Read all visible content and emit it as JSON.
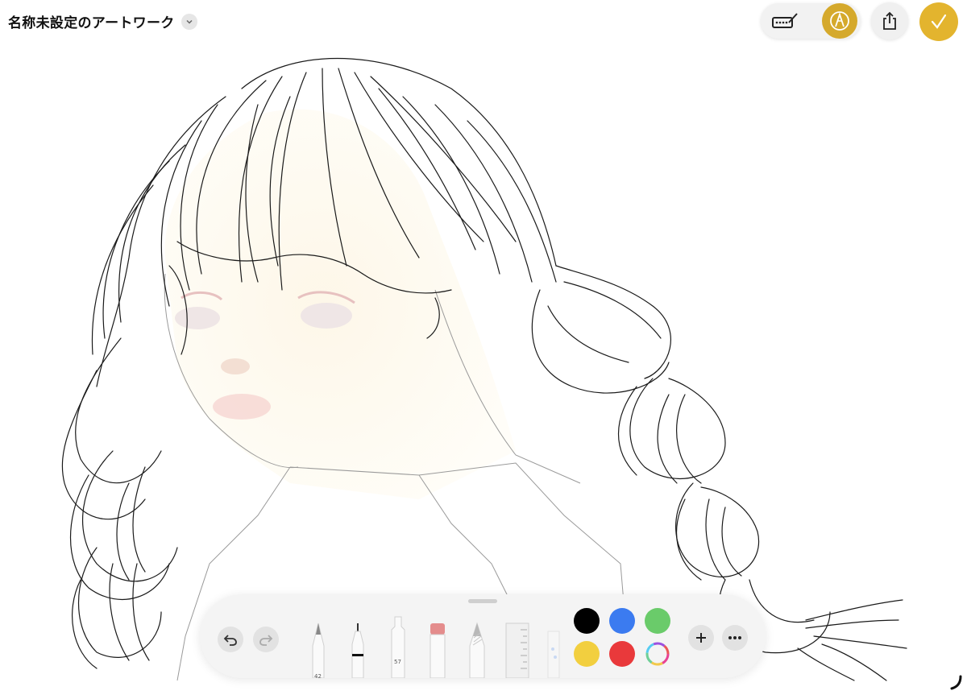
{
  "header": {
    "title": "名称未設定のアートワーク",
    "title_menu_icon": "chevron-down-icon"
  },
  "top_controls": {
    "markup_icon": "hand-drawing-icon",
    "pen_mode_icon": "pencil-tip-icon",
    "share_icon": "share-icon",
    "done_icon": "checkmark-icon",
    "accent_color": "#e3b42e"
  },
  "toolbar": {
    "undo_icon": "undo-icon",
    "redo_icon": "redo-icon",
    "tools": [
      {
        "name": "pen",
        "label": "42"
      },
      {
        "name": "monoline",
        "label": ""
      },
      {
        "name": "marker",
        "label": "57"
      },
      {
        "name": "eraser",
        "label": ""
      },
      {
        "name": "pencil",
        "label": ""
      },
      {
        "name": "ruler",
        "label": ""
      },
      {
        "name": "fill-tool",
        "label": ""
      }
    ],
    "colors": [
      "#000000",
      "#3b7bf0",
      "#6acb6a",
      "#f2cf3f",
      "#e9393b"
    ],
    "color_picker_icon": "color-wheel-icon",
    "add_icon": "plus-icon",
    "more_icon": "ellipsis-icon"
  }
}
